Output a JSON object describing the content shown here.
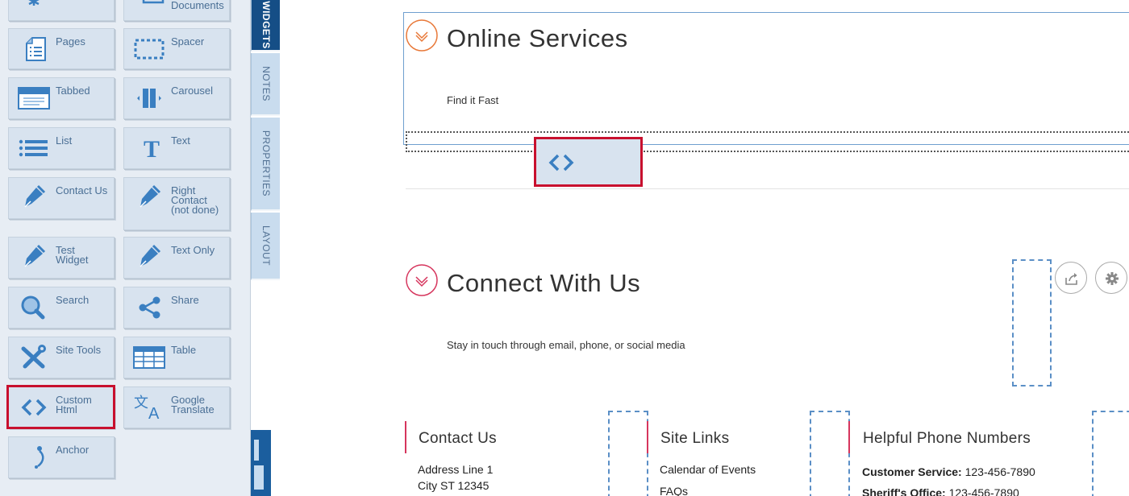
{
  "widgets": [
    {
      "label": "",
      "icon": "asterisk-icon"
    },
    {
      "label": "Documents",
      "icon": "documents-icon"
    },
    {
      "label": "Pages",
      "icon": "pages-icon"
    },
    {
      "label": "Spacer",
      "icon": "spacer-icon"
    },
    {
      "label": "Tabbed",
      "icon": "tabbed-icon"
    },
    {
      "label": "Carousel",
      "icon": "carousel-icon"
    },
    {
      "label": "List",
      "icon": "list-icon"
    },
    {
      "label": "Text",
      "icon": "text-icon"
    },
    {
      "label": "Contact Us",
      "icon": "pen-icon"
    },
    {
      "label": "Right Contact (not done)",
      "icon": "pen-icon"
    },
    {
      "label": "Test Widget",
      "icon": "pen-icon"
    },
    {
      "label": "Text Only",
      "icon": "pen-icon"
    },
    {
      "label": "Search",
      "icon": "search-icon"
    },
    {
      "label": "Share",
      "icon": "share-icon"
    },
    {
      "label": "Site Tools",
      "icon": "tools-icon"
    },
    {
      "label": "Table",
      "icon": "table-icon"
    },
    {
      "label": "Custom Html",
      "icon": "code-icon"
    },
    {
      "label": "Google Translate",
      "icon": "translate-icon"
    },
    {
      "label": "Anchor",
      "icon": "anchor-icon"
    }
  ],
  "tabs": [
    {
      "label": "WIDGETS",
      "active": true
    },
    {
      "label": "NOTES",
      "active": false
    },
    {
      "label": "PROPERTIES",
      "active": false
    },
    {
      "label": "LAYOUT",
      "active": false
    }
  ],
  "sections": {
    "online": {
      "title": "Online Services",
      "subtitle": "Find it Fast"
    },
    "connect": {
      "title": "Connect With Us",
      "subtitle": "Stay in touch through email, phone, or social media"
    }
  },
  "footer": {
    "contact": {
      "title": "Contact Us",
      "lines": [
        "Address Line 1",
        "City ST 12345"
      ]
    },
    "links": {
      "title": "Site Links",
      "lines": [
        "Calendar of Events",
        "FAQs"
      ]
    },
    "phones": {
      "title": "Helpful Phone Numbers",
      "lines": [
        {
          "label": "Customer Service:",
          "value": "123-456-7890"
        },
        {
          "label": "Sheriff's Office:",
          "value": "123-456-7890"
        }
      ]
    }
  },
  "colors": {
    "highlight": "#c8102e",
    "accent_orange": "#e87838",
    "accent_pink": "#d6355d",
    "tab_active": "#154e86",
    "widget_text": "#4a6f95",
    "dash": "#5b8fc6"
  }
}
